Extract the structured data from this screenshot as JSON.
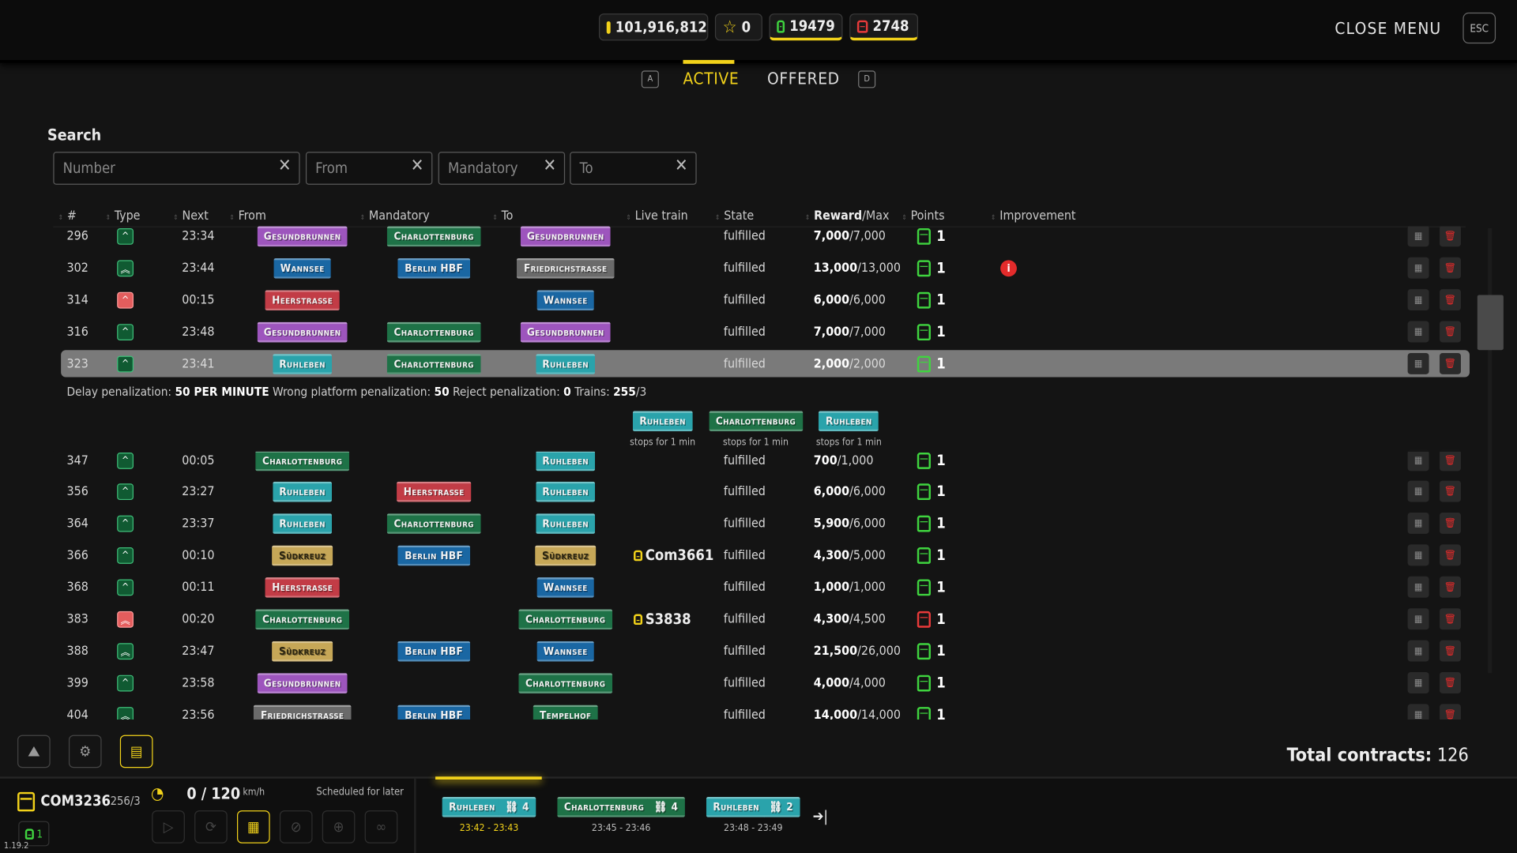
{
  "topbar": {
    "resources": [
      {
        "icon": "wallet-icon",
        "value": "101,916,812",
        "color": "#f2d21a"
      },
      {
        "icon": "star-icon",
        "value": "0",
        "color": "#f2d21a"
      },
      {
        "icon": "train-icon",
        "value": "19479",
        "color": "#3fd43f"
      },
      {
        "icon": "train-icon",
        "value": "2748",
        "color": "#e83a3a"
      }
    ],
    "close_menu": "CLOSE MENU",
    "esc": "ESC"
  },
  "tabs": {
    "prev_key": "A",
    "next_key": "D",
    "items": [
      {
        "label": "ACTIVE",
        "active": true
      },
      {
        "label": "OFFERED",
        "active": false
      }
    ]
  },
  "search": {
    "title": "Search",
    "fields": [
      {
        "placeholder": "Number",
        "value": ""
      },
      {
        "placeholder": "From",
        "value": ""
      },
      {
        "placeholder": "Mandatory",
        "value": ""
      },
      {
        "placeholder": "To",
        "value": ""
      }
    ],
    "clear": "✕"
  },
  "station_colors": {
    "Gesundbrunnen": "#9d55bd",
    "Charlottenburg": "#1e7247",
    "Wannsee": "#1a67a3",
    "Berlin HBF": "#1a67a3",
    "Friedrichstraße": "#6a6a6a",
    "Heerstraße": "#c23c46",
    "Ruhleben": "#2aa3ab",
    "Südkreuz": "#c6a757",
    "Tempelhof": "#1e7247"
  },
  "columns": [
    "#",
    "Type",
    "Next",
    "From",
    "Mandatory",
    "To",
    "Live train",
    "State",
    "Reward",
    "/Max",
    "Points",
    "Improvement"
  ],
  "rows": [
    {
      "num": "296",
      "type": "single",
      "type_color": "green",
      "next": "23:34",
      "from": "Gesundbrunnen",
      "mandatory": "Charlottenburg",
      "to": "Gesundbrunnen",
      "live": "",
      "state": "fulfilled",
      "reward": "7,000",
      "max": "/7,000",
      "points": "1",
      "points_color": "green",
      "improvement": false
    },
    {
      "num": "302",
      "type": "double",
      "type_color": "green",
      "next": "23:44",
      "from": "Wannsee",
      "mandatory": "Berlin HBF",
      "to": "Friedrichstraße",
      "live": "",
      "state": "fulfilled",
      "reward": "13,000",
      "max": "/13,000",
      "points": "1",
      "points_color": "green",
      "improvement": true
    },
    {
      "num": "314",
      "type": "single",
      "type_color": "red",
      "next": "00:15",
      "from": "Heerstraße",
      "mandatory": "",
      "to": "Wannsee",
      "live": "",
      "state": "fulfilled",
      "reward": "6,000",
      "max": "/6,000",
      "points": "1",
      "points_color": "green",
      "improvement": false
    },
    {
      "num": "316",
      "type": "single",
      "type_color": "green",
      "next": "23:48",
      "from": "Gesundbrunnen",
      "mandatory": "Charlottenburg",
      "to": "Gesundbrunnen",
      "live": "",
      "state": "fulfilled",
      "reward": "7,000",
      "max": "/7,000",
      "points": "1",
      "points_color": "green",
      "improvement": false
    },
    {
      "num": "323",
      "type": "single",
      "type_color": "green",
      "next": "23:41",
      "from": "Ruhleben",
      "mandatory": "Charlottenburg",
      "to": "Ruhleben",
      "live": "",
      "state": "fulfilled",
      "reward": "2,000",
      "max": "/2,000",
      "points": "1",
      "points_color": "green",
      "improvement": false,
      "selected": true
    },
    {
      "num": "347",
      "type": "single",
      "type_color": "green",
      "next": "00:05",
      "from": "Charlottenburg",
      "mandatory": "",
      "to": "Ruhleben",
      "live": "",
      "state": "fulfilled",
      "reward": "700",
      "max": "/1,000",
      "points": "1",
      "points_color": "green",
      "improvement": false
    },
    {
      "num": "356",
      "type": "single",
      "type_color": "green",
      "next": "23:27",
      "from": "Ruhleben",
      "mandatory": "Heerstraße",
      "to": "Ruhleben",
      "live": "",
      "state": "fulfilled",
      "reward": "6,000",
      "max": "/6,000",
      "points": "1",
      "points_color": "green",
      "improvement": false
    },
    {
      "num": "364",
      "type": "single",
      "type_color": "green",
      "next": "23:37",
      "from": "Ruhleben",
      "mandatory": "Charlottenburg",
      "to": "Ruhleben",
      "live": "",
      "state": "fulfilled",
      "reward": "5,900",
      "max": "/6,000",
      "points": "1",
      "points_color": "green",
      "improvement": false
    },
    {
      "num": "366",
      "type": "single",
      "type_color": "green",
      "next": "00:10",
      "from": "Südkreuz",
      "mandatory": "Berlin HBF",
      "to": "Südkreuz",
      "live": "Com3661",
      "state": "fulfilled",
      "reward": "4,300",
      "max": "/5,000",
      "points": "1",
      "points_color": "green",
      "improvement": false
    },
    {
      "num": "368",
      "type": "single",
      "type_color": "green",
      "next": "00:11",
      "from": "Heerstraße",
      "mandatory": "",
      "to": "Wannsee",
      "live": "",
      "state": "fulfilled",
      "reward": "1,000",
      "max": "/1,000",
      "points": "1",
      "points_color": "green",
      "improvement": false
    },
    {
      "num": "383",
      "type": "double",
      "type_color": "red",
      "next": "00:20",
      "from": "Charlottenburg",
      "mandatory": "",
      "to": "Charlottenburg",
      "live": "S3838",
      "state": "fulfilled",
      "reward": "4,300",
      "max": "/4,500",
      "points": "1",
      "points_color": "red",
      "improvement": false
    },
    {
      "num": "388",
      "type": "double",
      "type_color": "green",
      "next": "23:47",
      "from": "Südkreuz",
      "mandatory": "Berlin HBF",
      "to": "Wannsee",
      "live": "",
      "state": "fulfilled",
      "reward": "21,500",
      "max": "/26,000",
      "points": "1",
      "points_color": "green",
      "improvement": false
    },
    {
      "num": "399",
      "type": "single",
      "type_color": "green",
      "next": "23:58",
      "from": "Gesundbrunnen",
      "mandatory": "",
      "to": "Charlottenburg",
      "live": "",
      "state": "fulfilled",
      "reward": "4,000",
      "max": "/4,000",
      "points": "1",
      "points_color": "green",
      "improvement": false
    },
    {
      "num": "404",
      "type": "double",
      "type_color": "green",
      "next": "23:56",
      "from": "Friedrichstraße",
      "mandatory": "Berlin HBF",
      "to": "Tempelhof",
      "live": "",
      "state": "fulfilled",
      "reward": "14,000",
      "max": "/14,000",
      "points": "1",
      "points_color": "green",
      "improvement": false
    }
  ],
  "detail": {
    "delay_label": "Delay penalization: ",
    "delay_value": "50 PER MINUTE",
    "wrong_label": " Wrong platform penalization: ",
    "wrong_value": "50",
    "reject_label": " Reject penalization: ",
    "reject_value": "0",
    "trains_label": " Trains: ",
    "trains_value": "255",
    "trains_suffix": "/3",
    "stops": [
      {
        "station": "Ruhleben",
        "note": "stops for 1 min"
      },
      {
        "station": "Charlottenburg",
        "note": "stops for 1 min"
      },
      {
        "station": "Ruhleben",
        "note": "stops for 1 min"
      }
    ]
  },
  "footer": {
    "total_label": "Total contracts:",
    "total_value": "126"
  },
  "bottom_tools": [
    "map-icon",
    "cpu-icon",
    "contracts-icon"
  ],
  "train_panel": {
    "name": "COM3236",
    "id_suffix": "256/3",
    "speed": "0 / 120",
    "unit": "km/h",
    "status": "Scheduled for later",
    "badge": "1",
    "version": "1.19.2",
    "controls": [
      "play-icon",
      "refresh-icon",
      "schedule-icon",
      "no-route-icon",
      "target-icon",
      "link-icon"
    ],
    "stops": [
      {
        "station": "Ruhleben",
        "platform": "4",
        "time": "23:42 - 23:43",
        "current": true
      },
      {
        "station": "Charlottenburg",
        "platform": "4",
        "time": "23:45 - 23:46",
        "current": false
      },
      {
        "station": "Ruhleben",
        "platform": "2",
        "time": "23:48 - 23:49",
        "current": false
      }
    ]
  }
}
